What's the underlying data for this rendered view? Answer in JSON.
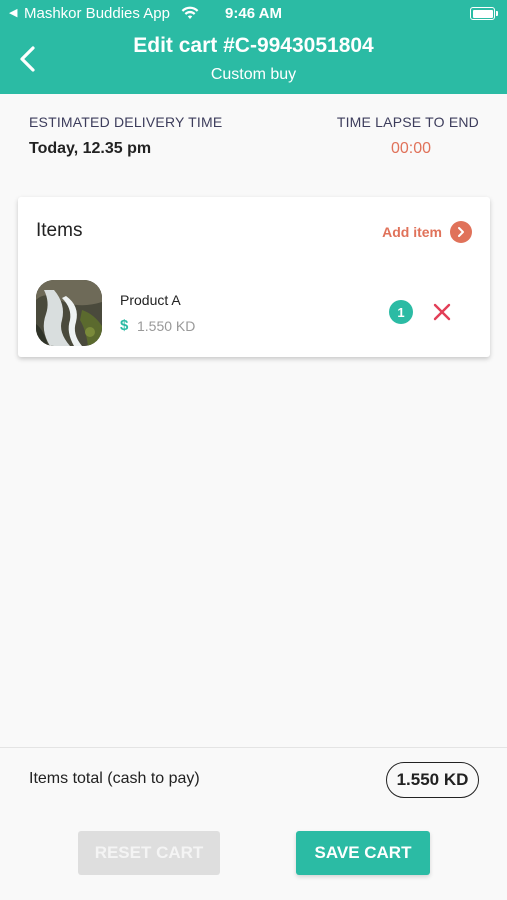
{
  "status_bar": {
    "back_glyph": "◀",
    "app_name": "Mashkor Buddies App",
    "time": "9:46 AM",
    "wifi_icon": "wifi-icon",
    "battery_icon": "battery-icon"
  },
  "header": {
    "title": "Edit cart #C-9943051804",
    "subtitle": "Custom buy",
    "back_icon": "chevron-left-icon"
  },
  "delivery": {
    "estimated_label": "ESTIMATED DELIVERY TIME",
    "estimated_value": "Today, 12.35 pm",
    "lapse_label": "TIME LAPSE TO END",
    "lapse_value": "00:00"
  },
  "items_section": {
    "heading": "Items",
    "add_item_label": "Add item",
    "add_item_icon": "chevron-right-icon",
    "items": [
      {
        "name": "Product A",
        "currency_symbol": "$",
        "price": "1.550 KD",
        "quantity": "1",
        "remove_icon": "close-icon"
      }
    ]
  },
  "footer": {
    "total_label": "Items total (cash to pay)",
    "total_value": "1.550 KD",
    "reset_label": "RESET CART",
    "save_label": "SAVE CART"
  },
  "colors": {
    "brand": "#2bbba4",
    "accent": "#e0725a",
    "remove": "#e23e57",
    "disabled": "#dedede"
  }
}
